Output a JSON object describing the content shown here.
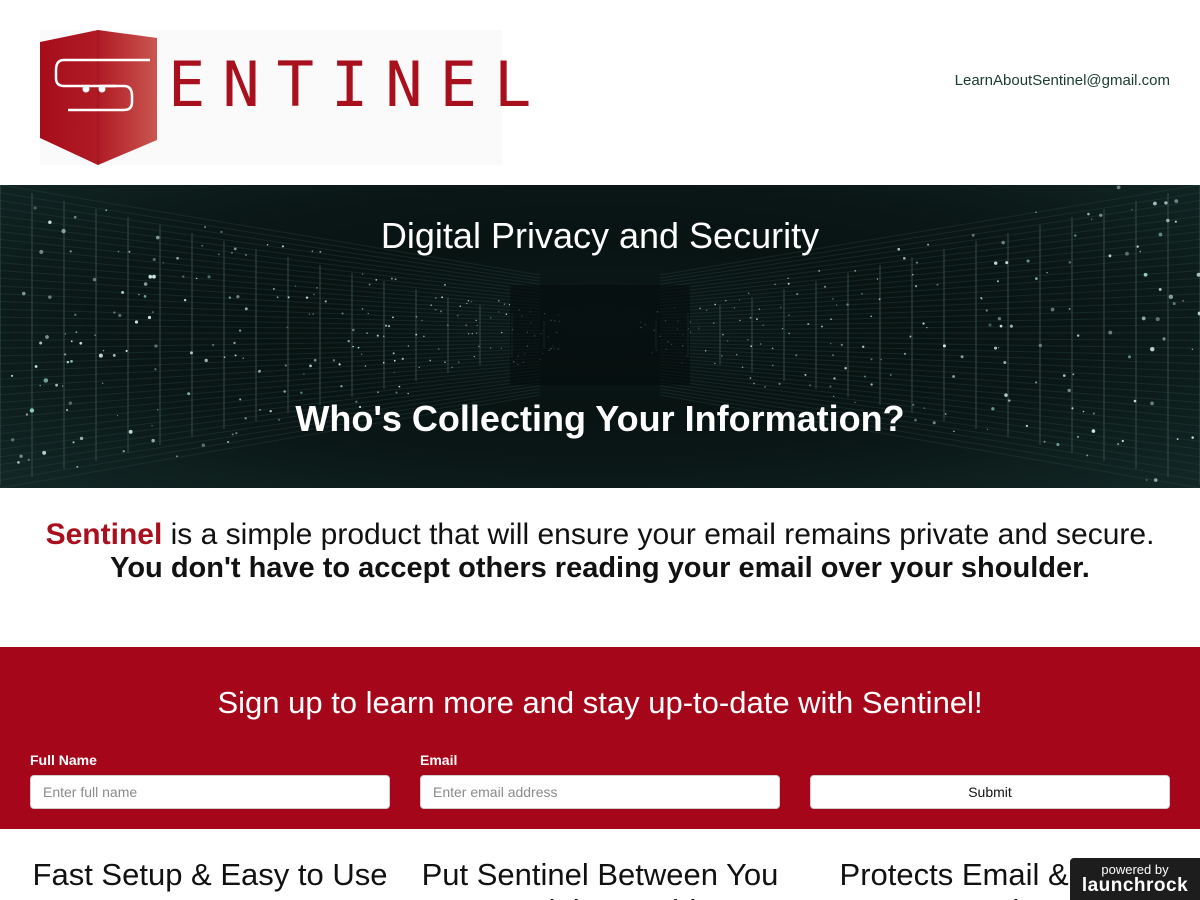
{
  "header": {
    "logo_text": "ENTINEL",
    "contact_email": "LearnAboutSentinel@gmail.com"
  },
  "hero": {
    "subtitle": "Digital Privacy and Security",
    "title": "Who's Collecting Your Information?"
  },
  "intro": {
    "brand": "Sentinel",
    "line1_rest": " is a simple product that will ensure your email remains private and secure.",
    "line2": "You don't have to accept others reading your email over your shoulder."
  },
  "signup": {
    "title": "Sign up to learn more and stay up-to-date with Sentinel!",
    "name_label": "Full Name",
    "name_placeholder": "Enter full name",
    "email_label": "Email",
    "email_placeholder": "Enter email address",
    "submit_label": "Submit"
  },
  "features": [
    {
      "title": "Fast Setup & Easy to Use"
    },
    {
      "title": "Put Sentinel Between You and the World"
    },
    {
      "title": "Protects Email & Web Browsing"
    }
  ],
  "badge": {
    "line1": "powered by",
    "line2": "launchrock"
  },
  "colors": {
    "brand_red": "#a8101d",
    "signup_bg": "#a6061a",
    "hero_bg": "#0b1918"
  }
}
